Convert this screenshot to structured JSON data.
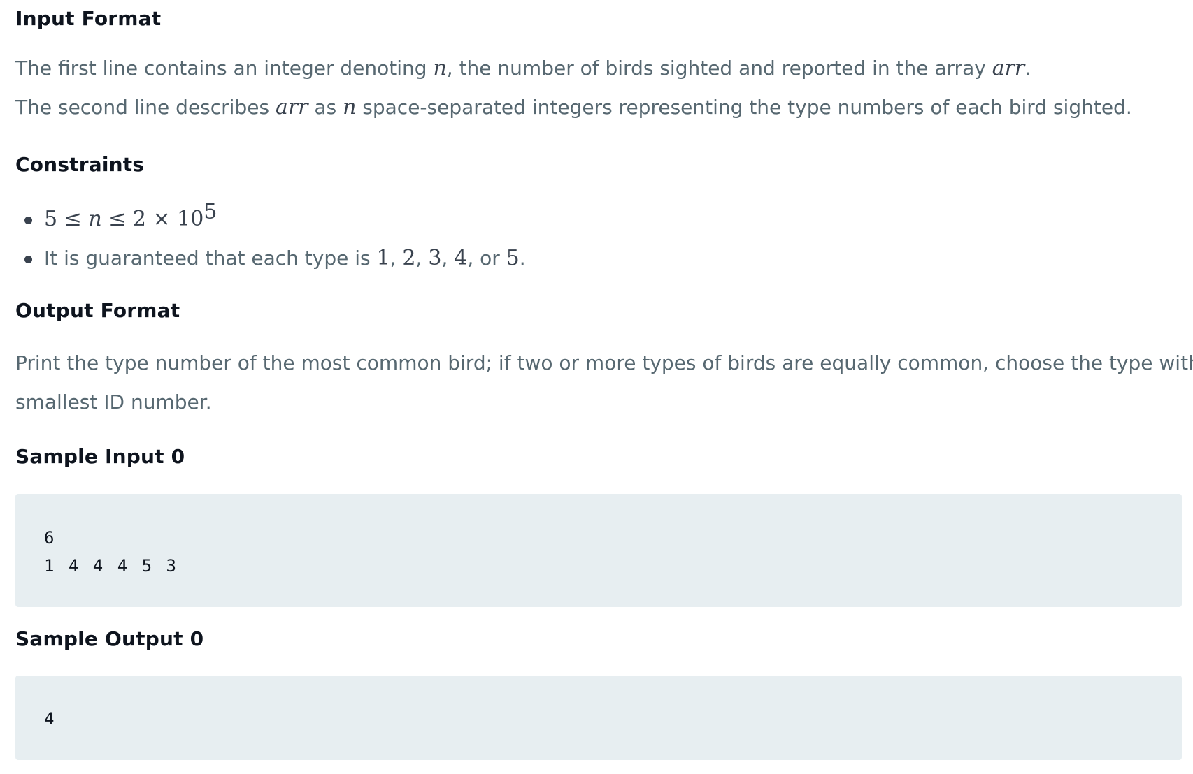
{
  "sections": {
    "input_format": {
      "heading": "Input Format",
      "line1": {
        "pre": "The first line contains an integer denoting ",
        "var1": "n",
        "mid": ", the number of birds sighted and reported in the array ",
        "var2": "arr",
        "post": "."
      },
      "line2": {
        "pre": "The second line describes ",
        "var1": "arr",
        "mid1": " as ",
        "var2": "n",
        "post": " space-separated integers representing the type numbers of each bird sighted."
      }
    },
    "constraints": {
      "heading": "Constraints",
      "item1": {
        "a": "5",
        "le1": " ≤ ",
        "n": "n",
        "le2": " ≤ ",
        "b": "2 × 10",
        "exp": "5"
      },
      "item2": {
        "pre": "It is guaranteed that each type is ",
        "n1": "1",
        "c1": ", ",
        "n2": "2",
        "c2": ", ",
        "n3": "3",
        "c3": ", ",
        "n4": "4",
        "c4": ", or ",
        "n5": "5",
        "post": "."
      }
    },
    "output_format": {
      "heading": "Output Format",
      "text_line1": "Print the type number of the most common bird; if two or more types of birds are equally common, choose the type with the",
      "text_line2": "smallest ID number."
    },
    "sample_input": {
      "heading": "Sample Input 0",
      "line1": "6",
      "line2": "1 4 4 4 5 3"
    },
    "sample_output": {
      "heading": "Sample Output 0",
      "line1": "4"
    }
  },
  "colors": {
    "heading": "#0e141e",
    "body_text": "#576871",
    "code_bg": "#e7eef1"
  }
}
